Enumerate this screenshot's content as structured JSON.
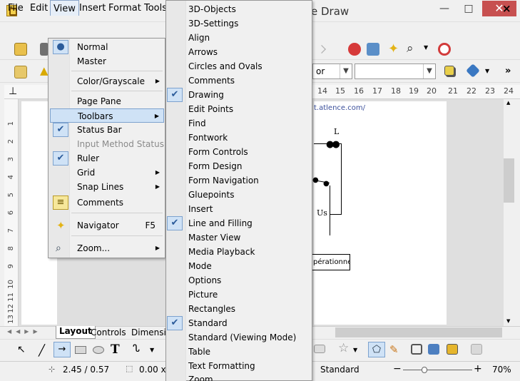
{
  "window": {
    "title": "e Draw",
    "min": "—",
    "max": "□",
    "close": "✕"
  },
  "menubar": {
    "file": "File",
    "edit": "Edit",
    "view": "View",
    "insert": "Insert",
    "format": "Format",
    "tools": "Tools",
    "doc_close": "×"
  },
  "toolbar": {
    "combo1": "or",
    "combo2": ""
  },
  "ruler": {
    "h": [
      "14",
      "15",
      "16",
      "17",
      "18",
      "19",
      "20",
      "21",
      "22",
      "23",
      "24"
    ],
    "v": [
      "1",
      "2",
      "3",
      "4",
      "5",
      "6",
      "7",
      "8",
      "9",
      "10",
      "11",
      "12",
      "13"
    ]
  },
  "drawing": {
    "url": "t.atlence.com/",
    "label_L": "L",
    "label_Us": "Us",
    "box": "pérationnel"
  },
  "tabs": {
    "layout": "Layout",
    "controls": "Controls",
    "dimensions": "Dimensio"
  },
  "status": {
    "position": "2.45 / 0.57",
    "size": "0.00 x",
    "style": "Standard",
    "zoom": "70%"
  },
  "view_menu": {
    "items": [
      {
        "label": "Normal",
        "checked": true
      },
      {
        "label": "Master",
        "checked": false
      },
      {
        "label": "Color/Grayscale",
        "sub": true
      },
      {
        "label": "Page Pane"
      },
      {
        "label": "Toolbars",
        "sub": true
      },
      {
        "label": "Status Bar",
        "checked": true
      },
      {
        "label": "Input Method Status",
        "disabled": true
      },
      {
        "label": "Ruler",
        "checked": true
      },
      {
        "label": "Grid",
        "sub": true
      },
      {
        "label": "Snap Lines",
        "sub": true
      },
      {
        "label": "Comments"
      },
      {
        "label": "Navigator",
        "shortcut": "F5"
      },
      {
        "label": "Zoom...",
        "sub": true
      }
    ]
  },
  "toolbars_menu": {
    "items": [
      {
        "label": "3D-Objects"
      },
      {
        "label": "3D-Settings"
      },
      {
        "label": "Align"
      },
      {
        "label": "Arrows"
      },
      {
        "label": "Circles and Ovals"
      },
      {
        "label": "Comments"
      },
      {
        "label": "Drawing",
        "checked": true
      },
      {
        "label": "Edit Points"
      },
      {
        "label": "Find"
      },
      {
        "label": "Fontwork"
      },
      {
        "label": "Form Controls"
      },
      {
        "label": "Form Design"
      },
      {
        "label": "Form Navigation"
      },
      {
        "label": "Gluepoints"
      },
      {
        "label": "Insert"
      },
      {
        "label": "Line and Filling",
        "checked": true
      },
      {
        "label": "Master View"
      },
      {
        "label": "Media Playback"
      },
      {
        "label": "Mode"
      },
      {
        "label": "Options"
      },
      {
        "label": "Picture"
      },
      {
        "label": "Rectangles"
      },
      {
        "label": "Standard",
        "checked": true
      },
      {
        "label": "Standard (Viewing Mode)"
      },
      {
        "label": "Table"
      },
      {
        "label": "Text Formatting"
      },
      {
        "label": "Zoom"
      }
    ]
  },
  "colors": {
    "accent": "#cfe2f6",
    "close_red": "#c75050"
  }
}
